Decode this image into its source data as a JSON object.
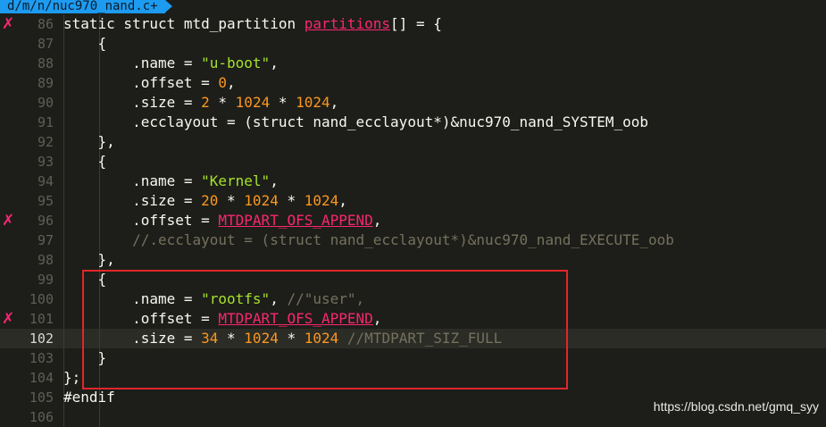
{
  "tab": {
    "filename": "d/m/n/nuc970_nand.c+"
  },
  "error_mark": "✗",
  "lines": [
    {
      "num": "86",
      "error": true,
      "current": false,
      "text": "static struct mtd_partition partitions[] = {"
    },
    {
      "num": "87",
      "error": false,
      "current": false,
      "text": "    {"
    },
    {
      "num": "88",
      "error": false,
      "current": false,
      "text": "        .name = \"u-boot\","
    },
    {
      "num": "89",
      "error": false,
      "current": false,
      "text": "        .offset = 0,"
    },
    {
      "num": "90",
      "error": false,
      "current": false,
      "text": "        .size = 2 * 1024 * 1024,"
    },
    {
      "num": "91",
      "error": false,
      "current": false,
      "text": "        .ecclayout = (struct nand_ecclayout*)&nuc970_nand_SYSTEM_oob"
    },
    {
      "num": "92",
      "error": false,
      "current": false,
      "text": "    },"
    },
    {
      "num": "93",
      "error": false,
      "current": false,
      "text": "    {"
    },
    {
      "num": "94",
      "error": false,
      "current": false,
      "text": "        .name = \"Kernel\","
    },
    {
      "num": "95",
      "error": false,
      "current": false,
      "text": "        .size = 20 * 1024 * 1024,"
    },
    {
      "num": "96",
      "error": true,
      "current": false,
      "text": "        .offset = MTDPART_OFS_APPEND,"
    },
    {
      "num": "97",
      "error": false,
      "current": false,
      "text": "        //.ecclayout = (struct nand_ecclayout*)&nuc970_nand_EXECUTE_oob"
    },
    {
      "num": "98",
      "error": false,
      "current": false,
      "text": "    },"
    },
    {
      "num": "99",
      "error": false,
      "current": false,
      "text": "    {"
    },
    {
      "num": "100",
      "error": false,
      "current": false,
      "text": "        .name = \"rootfs\", //\"user\","
    },
    {
      "num": "101",
      "error": true,
      "current": false,
      "text": "        .offset = MTDPART_OFS_APPEND,"
    },
    {
      "num": "102",
      "error": false,
      "current": true,
      "text": "        .size = 34 * 1024 * 1024 //MTDPART_SIZ_FULL"
    },
    {
      "num": "103",
      "error": false,
      "current": false,
      "text": "    }"
    },
    {
      "num": "104",
      "error": false,
      "current": false,
      "text": "};"
    },
    {
      "num": "105",
      "error": false,
      "current": false,
      "text": "#endif"
    },
    {
      "num": "106",
      "error": false,
      "current": false,
      "text": ""
    }
  ],
  "watermark": "https://blog.csdn.net/gmq_syy",
  "colors": {
    "background": "#1d1e19",
    "tab": "#1d9bf0",
    "string": "#a6e22e",
    "number": "#fd971f",
    "error": "#f92672",
    "comment": "#75715e",
    "highlight_box": "#e0262b"
  }
}
